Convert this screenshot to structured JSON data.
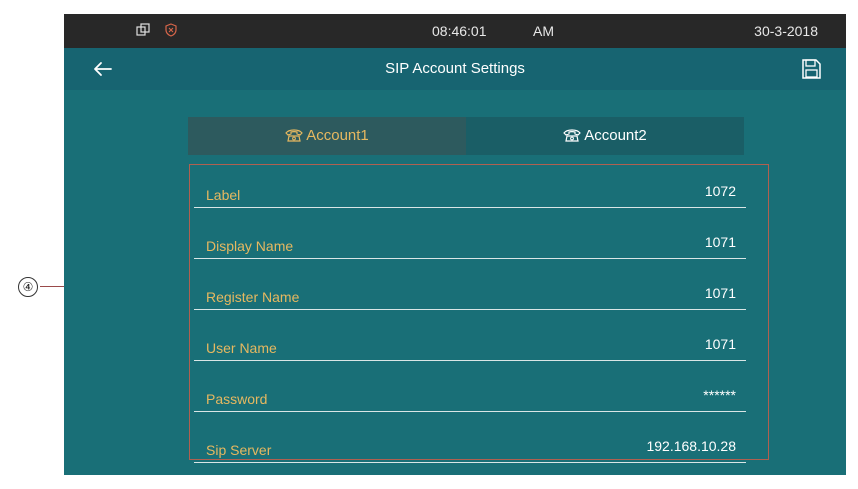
{
  "callout": {
    "number": "④"
  },
  "status_bar": {
    "time": "08:46:01",
    "ampm": "AM",
    "date": "30-3-2018"
  },
  "header": {
    "title": "SIP Account Settings"
  },
  "tabs": [
    {
      "label": "Account1",
      "selected": true
    },
    {
      "label": "Account2",
      "selected": false
    }
  ],
  "fields": [
    {
      "label": "Label",
      "value": "1072"
    },
    {
      "label": "Display Name",
      "value": "1071"
    },
    {
      "label": "Register Name",
      "value": "1071"
    },
    {
      "label": "User Name",
      "value": "1071"
    },
    {
      "label": "Password",
      "value": "******"
    },
    {
      "label": "Sip Server",
      "value": "192.168.10.28"
    }
  ],
  "colors": {
    "status_bar": "#282828",
    "title_bar": "#176471",
    "background": "#196f77",
    "label_text": "#e6b860",
    "value_text": "#ffffff",
    "annotation_box": "#b06050"
  },
  "icons": [
    "windows-icon",
    "shield-icon",
    "back-arrow-icon",
    "save-icon",
    "phone-icon"
  ]
}
